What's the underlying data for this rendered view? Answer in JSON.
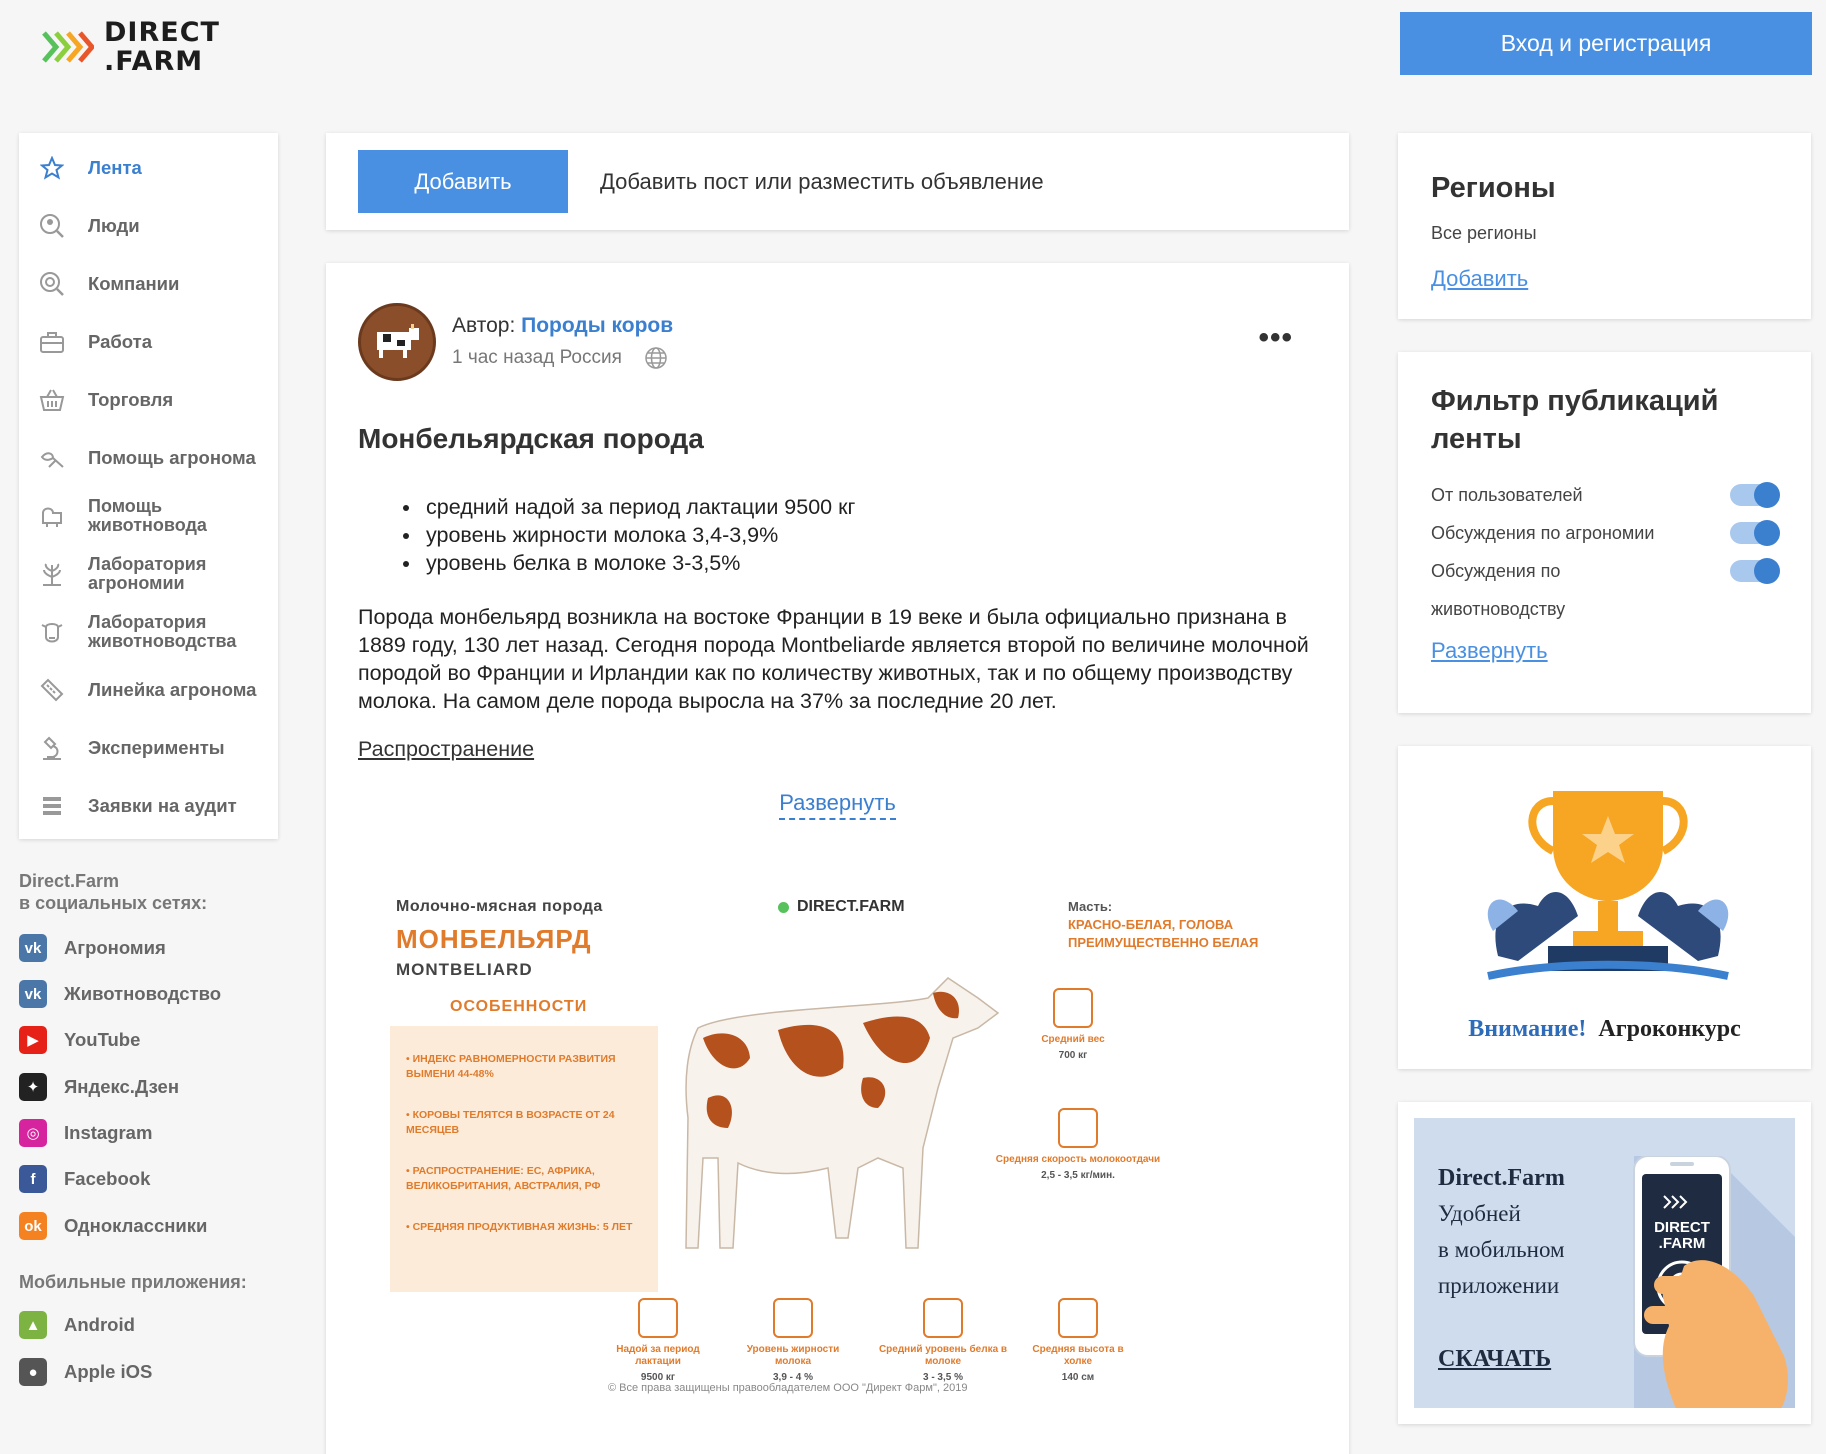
{
  "header": {
    "logo_line1": "DIRECT",
    "logo_line2": ".FARM",
    "login_label": "Вход и регистрация"
  },
  "sidebar": {
    "items": [
      {
        "label": "Лента",
        "icon": "star-icon",
        "active": true
      },
      {
        "label": "Люди",
        "icon": "people-search-icon"
      },
      {
        "label": "Компании",
        "icon": "company-search-icon"
      },
      {
        "label": "Работа",
        "icon": "briefcase-icon"
      },
      {
        "label": "Торговля",
        "icon": "basket-icon"
      },
      {
        "label": "Помощь агронома",
        "icon": "plant-help-icon"
      },
      {
        "label": "Помощь животновода",
        "icon": "animal-help-icon"
      },
      {
        "label": "Лаборатория агрономии",
        "icon": "plant-lab-icon"
      },
      {
        "label": "Лаборатория животноводства",
        "icon": "cow-lab-icon"
      },
      {
        "label": "Линейка агронома",
        "icon": "ruler-icon"
      },
      {
        "label": "Эксперименты",
        "icon": "microscope-icon"
      },
      {
        "label": "Заявки на аудит",
        "icon": "list-icon"
      }
    ],
    "social_title": "Direct.Farm\nв социальных сетях:",
    "social": [
      {
        "label": "Агрономия",
        "icon": "vk-icon",
        "color": "#4a76a8"
      },
      {
        "label": "Животноводство",
        "icon": "vk-icon",
        "color": "#4a76a8"
      },
      {
        "label": "YouTube",
        "icon": "youtube-icon",
        "color": "#e62117"
      },
      {
        "label": "Яндекс.Дзен",
        "icon": "zen-icon",
        "color": "#222222"
      },
      {
        "label": "Instagram",
        "icon": "instagram-icon",
        "color": "#d6249f"
      },
      {
        "label": "Facebook",
        "icon": "facebook-icon",
        "color": "#3b5998"
      },
      {
        "label": "Одноклассники",
        "icon": "odnoklassniki-icon",
        "color": "#f58220"
      }
    ],
    "apps_title": "Мобильные приложения:",
    "apps": [
      {
        "label": "Android",
        "icon": "android-icon",
        "color": "#7cb342"
      },
      {
        "label": "Apple iOS",
        "icon": "apple-icon",
        "color": "#555555"
      }
    ]
  },
  "composer": {
    "button_label": "Добавить",
    "prompt": "Добавить пост или разместить объявление"
  },
  "post": {
    "author_prefix": "Автор:",
    "author_name": "Породы коров",
    "meta": "1 час назад Россия",
    "more": "•••",
    "title": "Монбельярдская порода",
    "bullets": [
      "средний надой за период лактации 9500 кг",
      "уровень жирности молока 3,4-3,9%",
      "уровень белка в молоке 3-3,5%"
    ],
    "body": "Порода монбельярд возникла на востоке Франции в 19 веке и была официально признана в 1889 году, 130 лет назад. Сегодня порода Montbeliarde является второй по величине молочной породой во Франции и Ирландии как по количеству животных, так и по общему производству молока. На самом деле порода выросла на 37% за последние 20 лет.",
    "link": "Распространение",
    "expand": "Развернуть"
  },
  "infographic": {
    "subtitle": "Молочно-мясная порода",
    "title": "МОНБЕЛЬЯРД",
    "latin": "MONTBELIARD",
    "brand": "DIRECT.FARM",
    "suit_label": "Масть:",
    "suit_value": "КРАСНО-БЕЛАЯ, ГОЛОВА ПРЕИМУЩЕСТВЕННО БЕЛАЯ",
    "features_title": "ОСОБЕННОСТИ",
    "features": [
      "• ИНДЕКС РАВНОМЕРНОСТИ РАЗВИТИЯ ВЫМЕНИ 44-48%",
      "• КОРОВЫ ТЕЛЯТСЯ В ВОЗРАСТЕ ОТ 24 МЕСЯЦЕВ",
      "• РАСПРОСТРАНЕНИЕ: ЕС, АФРИКА, ВЕЛИКОБРИТАНИЯ, АВСТРАЛИЯ, РФ",
      "• СРЕДНЯЯ ПРОДУКТИВНАЯ ЖИЗНЬ: 5 ЛЕТ"
    ],
    "stats": [
      {
        "label": "Средний вес",
        "value": "700 кг"
      },
      {
        "label": "Средняя скорость молокоотдачи",
        "value": "2,5 - 3,5 кг/мин."
      },
      {
        "label": "Надой за период лактации",
        "value": "9500 кг"
      },
      {
        "label": "Уровень жирности молока",
        "value": "3,9 - 4 %"
      },
      {
        "label": "Средний уровень белка в молоке",
        "value": "3 - 3,5 %"
      },
      {
        "label": "Средняя высота в холке",
        "value": "140 см"
      }
    ],
    "copyright": "© Все права защищены правообладателем ООО \"Директ Фарм\", 2019"
  },
  "regions": {
    "title": "Регионы",
    "value": "Все регионы",
    "add_label": "Добавить"
  },
  "filter": {
    "title": "Фильтр публикаций ленты",
    "options": [
      {
        "label": "От пользователей",
        "on": true
      },
      {
        "label": "Обсуждения по агрономии",
        "on": true
      },
      {
        "label": "Обсуждения по животноводству",
        "on": true
      }
    ],
    "expand_label": "Развернуть"
  },
  "contest": {
    "attention": "Внимание!",
    "name": "Агроконкурс"
  },
  "app_banner": {
    "title": "Direct.Farm",
    "line1": "Удобней",
    "line2": "в мобильном",
    "line3": "приложении",
    "download": "СКАЧАТЬ",
    "phone_logo_line1": "DIRECT",
    "phone_logo_line2": ".FARM"
  },
  "colors": {
    "accent": "#4a90e2",
    "link": "#3b7fcf",
    "orange": "#e07b2c"
  }
}
